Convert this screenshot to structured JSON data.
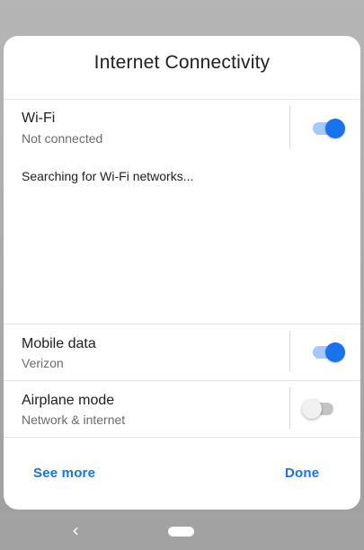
{
  "dialog": {
    "title": "Internet Connectivity",
    "wifi": {
      "label": "Wi-Fi",
      "status": "Not connected",
      "enabled": true,
      "message": "Searching for Wi-Fi networks..."
    },
    "mobile_data": {
      "label": "Mobile data",
      "status": "Verizon",
      "enabled": true
    },
    "airplane_mode": {
      "label": "Airplane mode",
      "status": "Network & internet",
      "enabled": false
    },
    "see_more_label": "See more",
    "done_label": "Done"
  },
  "colors": {
    "accent": "#1a73e8",
    "accent_track": "#a8c7fa",
    "off_track": "#c4c4c4"
  },
  "navigation": {
    "back_icon": "chevron-left-icon",
    "home_icon": "home-pill-icon"
  }
}
